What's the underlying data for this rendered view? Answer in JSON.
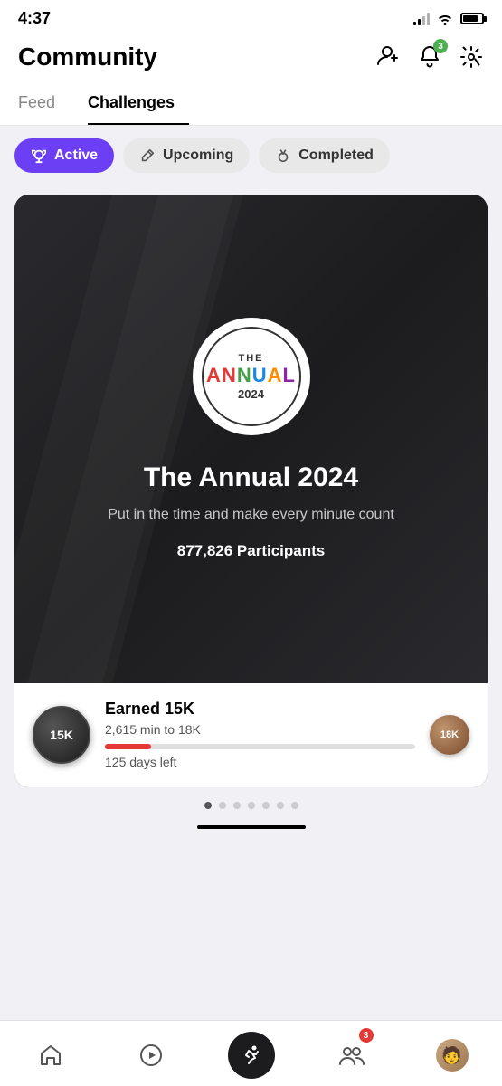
{
  "status": {
    "time": "4:37",
    "notification_count": "3"
  },
  "header": {
    "title": "Community",
    "add_person_icon": "add-person",
    "bell_icon": "bell",
    "gear_icon": "gear"
  },
  "tabs": [
    {
      "label": "Feed",
      "active": false
    },
    {
      "label": "Challenges",
      "active": true
    }
  ],
  "filters": [
    {
      "label": "Active",
      "icon": "trophy",
      "active": true
    },
    {
      "label": "Upcoming",
      "icon": "pencil-lines",
      "active": false
    },
    {
      "label": "Completed",
      "icon": "medal",
      "active": false
    }
  ],
  "challenge_card": {
    "logo_the": "THE",
    "logo_annual": "ANNUAL",
    "logo_year": "2024",
    "title": "The Annual 2024",
    "subtitle": "Put in the time and make every minute count",
    "participants": "877,826 Participants",
    "progress": {
      "earned_label": "Earned 15K",
      "current_badge": "15K",
      "minutes_label": "2,615 min to 18K",
      "days_label": "125 days left",
      "bar_pct": 15,
      "next_badge": "18K"
    }
  },
  "dots": {
    "count": 7,
    "active_index": 0
  },
  "bottom_nav": [
    {
      "icon": "home",
      "label": "home",
      "active": false
    },
    {
      "icon": "play",
      "label": "play",
      "active": false
    },
    {
      "icon": "run",
      "label": "activity",
      "active": true
    },
    {
      "icon": "people",
      "label": "community",
      "active": false,
      "badge": "3"
    },
    {
      "icon": "avatar",
      "label": "profile",
      "active": false
    }
  ]
}
